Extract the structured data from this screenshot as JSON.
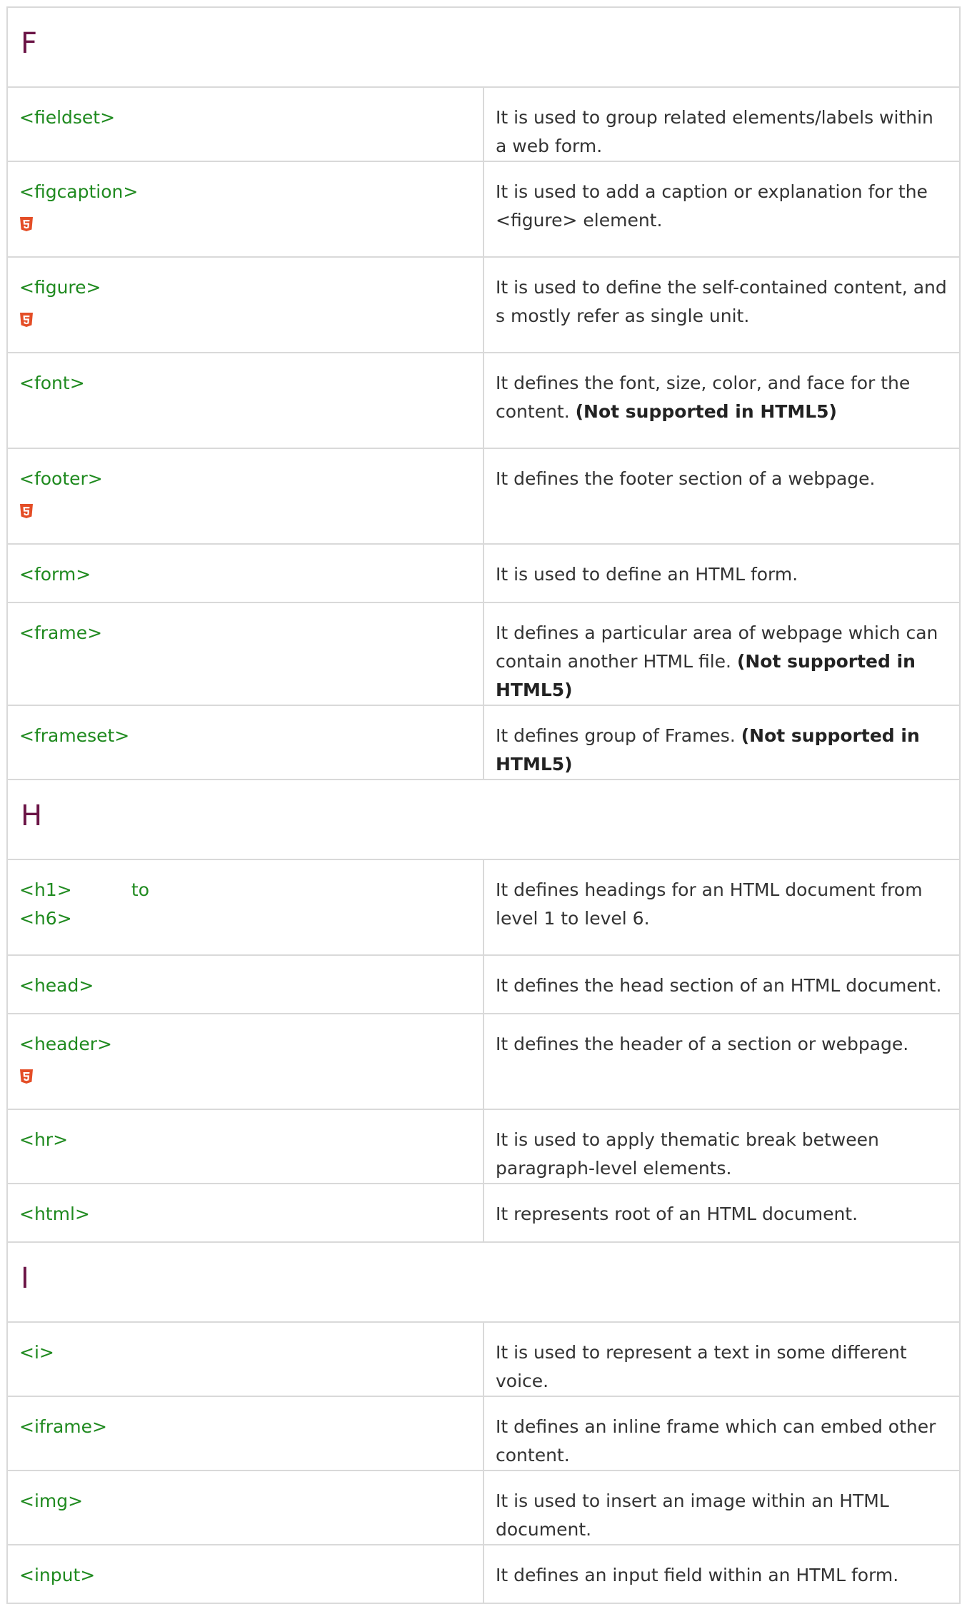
{
  "sections": [
    {
      "letter": "F",
      "rows": [
        {
          "tag": "<fieldset>",
          "desc": "It is used to group related elements/labels within a web form.",
          "html5": false
        },
        {
          "tag": "<figcaption>",
          "desc": "It is used to add a caption or explanation for the <figure> element.",
          "html5": true
        },
        {
          "tag": "<figure>",
          "desc": "It is used to define the self-contained content, and s mostly refer as single unit.",
          "html5": true
        },
        {
          "tag": "<font>",
          "desc": "It defines the font, size, color, and face for the content.",
          "note": "(Not supported in HTML5)",
          "html5": false
        },
        {
          "tag": "<footer>",
          "desc": "It defines the footer section of a webpage.",
          "html5": true
        },
        {
          "tag": "<form>",
          "desc": "It is used to define an HTML form.",
          "html5": false
        },
        {
          "tag": "<frame>",
          "desc": "It defines a particular area of webpage which can contain another HTML file.",
          "note": "(Not supported in HTML5)",
          "html5": false
        },
        {
          "tag": "<frameset>",
          "desc": "It defines group of Frames.",
          "note": "(Not supported in HTML5)",
          "html5": false
        }
      ]
    },
    {
      "letter": "H",
      "rows": [
        {
          "tag_a": "<h1>",
          "tag_mid": "to",
          "tag_b": "<h6>",
          "desc": "It defines headings for an HTML document from level 1 to level 6.",
          "html5": false
        },
        {
          "tag": "<head>",
          "desc": "It defines the head section of an HTML document.",
          "html5": false
        },
        {
          "tag": "<header>",
          "desc": "It defines the header of a section or webpage.",
          "html5": true
        },
        {
          "tag": "<hr>",
          "desc": "It is used to apply thematic break between paragraph-level elements.",
          "html5": false
        },
        {
          "tag": "<html>",
          "desc": "It represents root of an HTML document.",
          "html5": false
        }
      ]
    },
    {
      "letter": "I",
      "rows": [
        {
          "tag": "<i>",
          "desc": "It is used to represent a text in some different voice.",
          "html5": false
        },
        {
          "tag": "<iframe>",
          "desc": "It defines an inline frame which can embed other content.",
          "html5": false
        },
        {
          "tag": "<img>",
          "desc": "It is used to insert an image within an HTML document.",
          "html5": false
        },
        {
          "tag": "<input>",
          "desc": "It defines an input field within an HTML form.",
          "html5": false
        }
      ]
    }
  ],
  "colors": {
    "tag": "#1f8a1f",
    "letter": "#6b1446",
    "border": "#d9d9d9",
    "html5_badge": "#e44d26"
  },
  "icons": {
    "html5_badge": "html5-shield-icon"
  }
}
